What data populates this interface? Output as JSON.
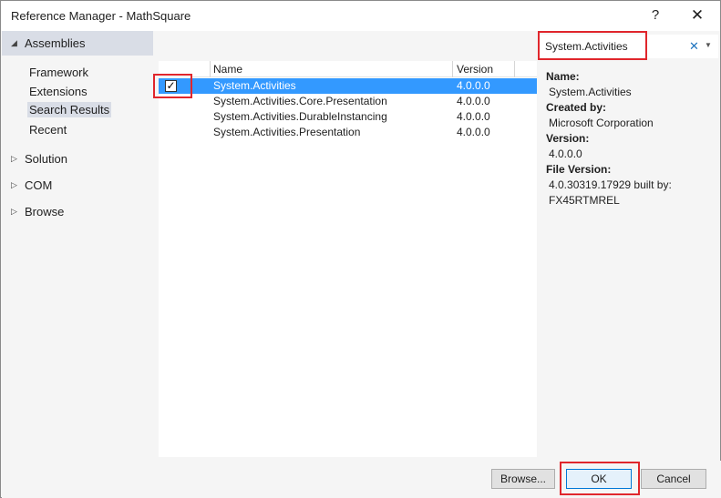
{
  "window": {
    "title": "Reference Manager - MathSquare",
    "help_glyph": "?",
    "close_glyph": "✕"
  },
  "nav": {
    "header": {
      "label": "Assemblies",
      "arrow": "◢"
    },
    "sub_items": [
      "Framework",
      "Extensions",
      "Search Results",
      "Recent"
    ],
    "selected_sub_item": "Search Results",
    "groups": [
      {
        "label": "Solution",
        "arrow": "▷"
      },
      {
        "label": "COM",
        "arrow": "▷"
      },
      {
        "label": "Browse",
        "arrow": "▷"
      }
    ]
  },
  "list": {
    "columns": {
      "name": "Name",
      "version": "Version"
    },
    "rows": [
      {
        "name": "System.Activities",
        "version": "4.0.0.0",
        "checked": true,
        "selected": true
      },
      {
        "name": "System.Activities.Core.Presentation",
        "version": "4.0.0.0",
        "checked": false,
        "selected": false
      },
      {
        "name": "System.Activities.DurableInstancing",
        "version": "4.0.0.0",
        "checked": false,
        "selected": false
      },
      {
        "name": "System.Activities.Presentation",
        "version": "4.0.0.0",
        "checked": false,
        "selected": false
      }
    ],
    "check_glyph": "✓"
  },
  "search": {
    "value": "System.Activities",
    "clear_glyph": "✕",
    "dropdown_glyph": "▼"
  },
  "details": {
    "name_label": "Name:",
    "name_value": "System.Activities",
    "created_label": "Created by:",
    "created_value": "Microsoft Corporation",
    "version_label": "Version:",
    "version_value": "4.0.0.0",
    "file_version_label": "File Version:",
    "file_version_value_line1": "4.0.30319.17929 built by:",
    "file_version_value_line2": "FX45RTMREL"
  },
  "footer": {
    "browse_label": "Browse...",
    "ok_label": "OK",
    "cancel_label": "Cancel"
  },
  "colors": {
    "selection": "#3399ff",
    "nav_selected": "#d9dde6",
    "highlight": "#e0262c"
  }
}
